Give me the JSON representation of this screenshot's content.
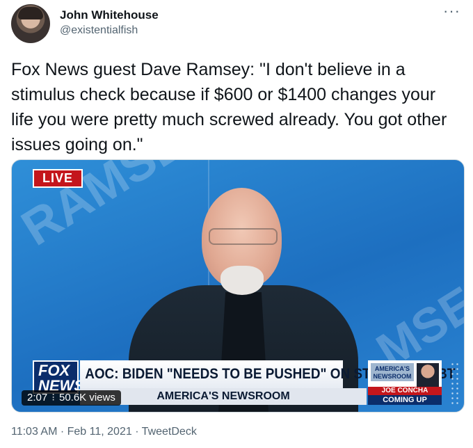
{
  "author": {
    "display_name": "John Whitehouse",
    "handle": "@existentialfish"
  },
  "tweet": {
    "text": "Fox News guest Dave Ramsey: \"I don't believe in a stimulus check because if $600 or $1400 changes your life you were pretty much screwed already. You got other issues going on.\""
  },
  "video": {
    "live_badge": "LIVE",
    "watermark_left": "RAMSE",
    "watermark_right": "MSE",
    "network_logo": "FOX NEWS",
    "headline": "AOC: BIDEN \"NEEDS TO BE PUSHED\" ON STUDENT DEBT",
    "program_name": "AMERICA'S NEWSROOM",
    "promo_brand": "AMERICA'S NEWSROOM",
    "promo_name": "JOE CONCHA",
    "promo_coming": "COMING UP",
    "duration": "2:07",
    "views": "50.6K views"
  },
  "meta": {
    "timestamp": "11:03 AM · Feb 11, 2021 · TweetDeck"
  },
  "colors": {
    "primary_text": "#0f1419",
    "secondary_text": "#536471",
    "fox_red": "#c4161c",
    "fox_blue": "#0b2d6b"
  },
  "icons": {
    "more": "more-dots-icon",
    "avatar": "avatar"
  }
}
